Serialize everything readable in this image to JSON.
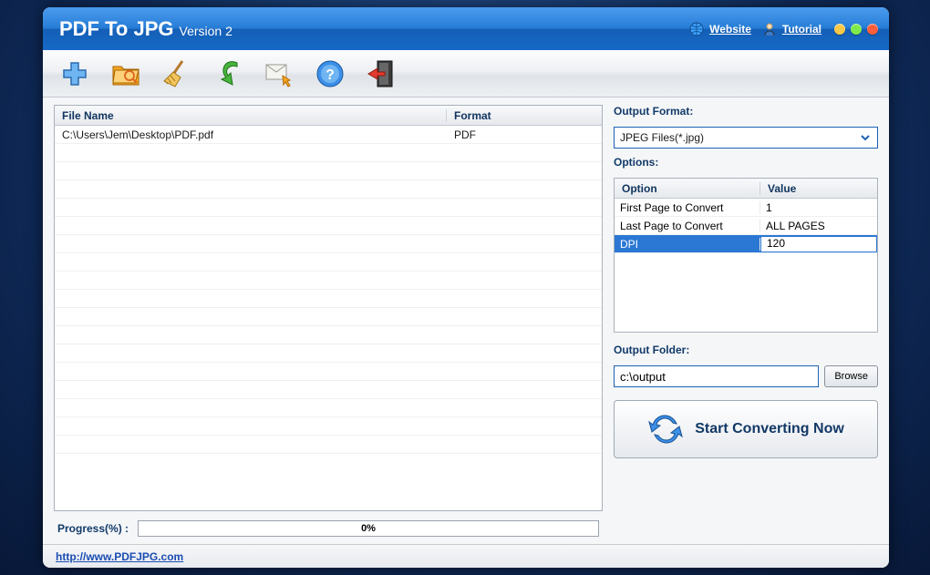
{
  "titlebar": {
    "app_title": "PDF To JPG",
    "version_label": "Version 2",
    "website_label": "Website",
    "tutorial_label": "Tutorial"
  },
  "filegrid": {
    "headers": {
      "file_name": "File Name",
      "format": "Format"
    },
    "rows": [
      {
        "file": "C:\\Users\\Jem\\Desktop\\PDF.pdf",
        "format": "PDF"
      }
    ]
  },
  "progress": {
    "label": "Progress(%)  :",
    "percent_text": "0%"
  },
  "output_format": {
    "label": "Output Format:",
    "selected": "JPEG Files(*.jpg)"
  },
  "options": {
    "label": "Options:",
    "headers": {
      "option": "Option",
      "value": "Value"
    },
    "rows": [
      {
        "option": "First Page to Convert",
        "value": "1"
      },
      {
        "option": "Last Page to Convert",
        "value": "ALL PAGES"
      },
      {
        "option": "DPI",
        "value": "120",
        "selected": true
      }
    ]
  },
  "output_folder": {
    "label": "Output Folder:",
    "value": "c:\\output",
    "browse_label": "Browse"
  },
  "convert": {
    "label": "Start Converting Now"
  },
  "footer": {
    "url_label": "http://www.PDFJPG.com"
  }
}
